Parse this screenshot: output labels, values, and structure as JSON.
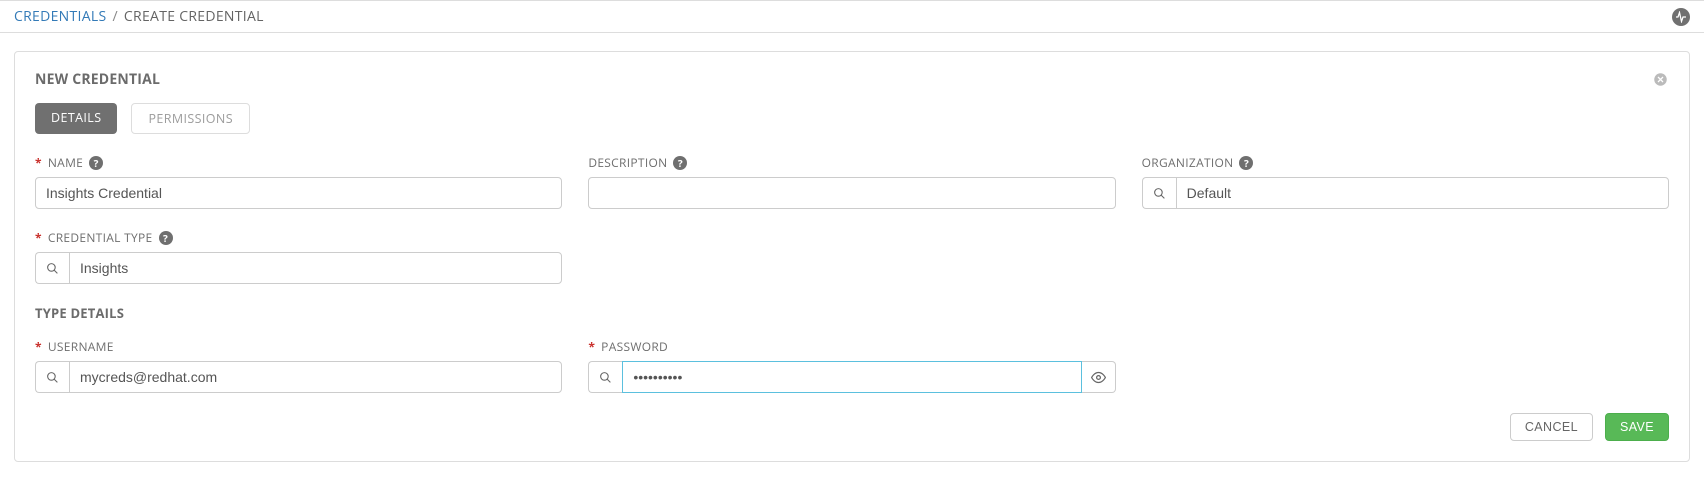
{
  "breadcrumb": {
    "root": "CREDENTIALS",
    "current": "CREATE CREDENTIAL"
  },
  "panel": {
    "title": "NEW CREDENTIAL"
  },
  "tabs": {
    "details": "DETAILS",
    "permissions": "PERMISSIONS"
  },
  "labels": {
    "name": "NAME",
    "description": "DESCRIPTION",
    "organization": "ORGANIZATION",
    "credential_type": "CREDENTIAL TYPE",
    "type_details": "TYPE DETAILS",
    "username": "USERNAME",
    "password": "PASSWORD"
  },
  "values": {
    "name": "Insights Credential",
    "description": "",
    "organization": "Default",
    "credential_type": "Insights",
    "username": "mycreds@redhat.com",
    "password": "••••••••••"
  },
  "buttons": {
    "cancel": "CANCEL",
    "save": "SAVE"
  }
}
